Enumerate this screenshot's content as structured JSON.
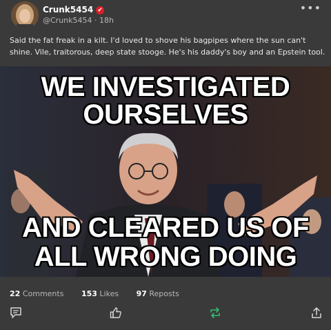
{
  "post": {
    "author": {
      "name": "Crunk5454",
      "verified_glyph": "✔",
      "handle": "@Crunk5454",
      "time": "18h"
    },
    "more_glyph": "•••",
    "text": "Said the fat freak in a kilt. I'd loved to shove his bagpipes where the sun can't shine. Vile, traitorous, deep state stooge. He's his daddy's boy and an Epstein tool.",
    "image": {
      "caption_top_1": "WE INVESTIGATED",
      "caption_top_2": "OURSELVES",
      "caption_bottom_1": "AND CLEARED US OF",
      "caption_bottom_2": "ALL WRONG DOING"
    },
    "stats": {
      "comments_count": "22",
      "comments_label": "Comments",
      "likes_count": "153",
      "likes_label": "Likes",
      "reposts_count": "97",
      "reposts_label": "Reposts"
    },
    "actions": [
      "comment-icon",
      "like-icon",
      "repost-icon",
      "share-icon"
    ],
    "colors": {
      "background": "#3a3a3a",
      "verified": "#d81f26",
      "repost": "#2fbf71"
    }
  }
}
